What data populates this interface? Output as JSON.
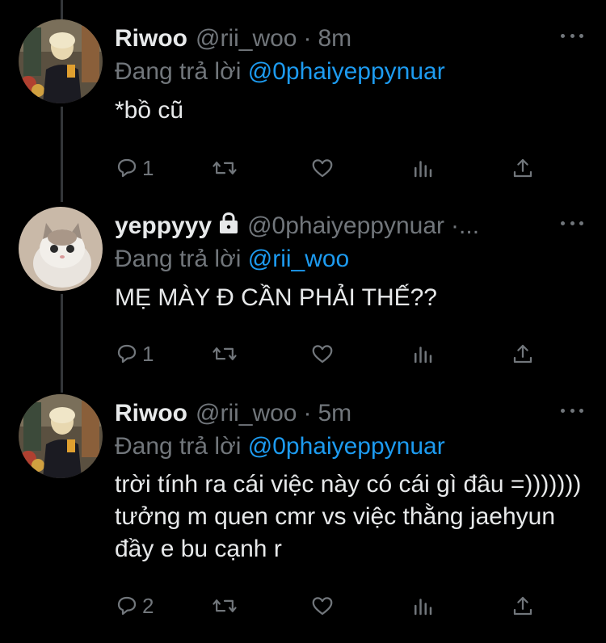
{
  "colors": {
    "background": "#000000",
    "text": "#e7e9ea",
    "muted": "#71767b",
    "link": "#1d9bf0",
    "thread_line": "#333639"
  },
  "tweets": [
    {
      "name": "Riwoo",
      "handle": "@rii_woo",
      "separator": "·",
      "time": "8m",
      "replying_prefix": "Đang trả lời",
      "replying_to": "@0phaiyeppynuar",
      "text": "*bồ cũ",
      "reply_count": "1",
      "avatar": "riwoo-avatar-photo",
      "protected": false
    },
    {
      "name": "yeppyyy",
      "handle": "@0phaiyeppynuar",
      "separator": "·...",
      "time": "",
      "replying_prefix": "Đang trả lời",
      "replying_to": "@rii_woo",
      "text": "MẸ MÀY Đ CẦN PHẢI THẾ??",
      "reply_count": "1",
      "avatar": "kitten-avatar-photo",
      "protected": true
    },
    {
      "name": "Riwoo",
      "handle": "@rii_woo",
      "separator": "·",
      "time": "5m",
      "replying_prefix": "Đang trả lời",
      "replying_to": "@0phaiyeppynuar",
      "text": "trời tính ra cái việc này có cái gì đâu =))))))) tưởng m quen cmr vs việc thằng jaehyun đầy e bu cạnh r",
      "reply_count": "2",
      "avatar": "riwoo-avatar-photo",
      "protected": false
    }
  ],
  "icons": {
    "reply": "reply-icon",
    "retweet": "retweet-icon",
    "like": "heart-icon",
    "analytics": "analytics-icon",
    "share": "share-icon",
    "more": "more-icon",
    "lock": "lock-icon"
  }
}
